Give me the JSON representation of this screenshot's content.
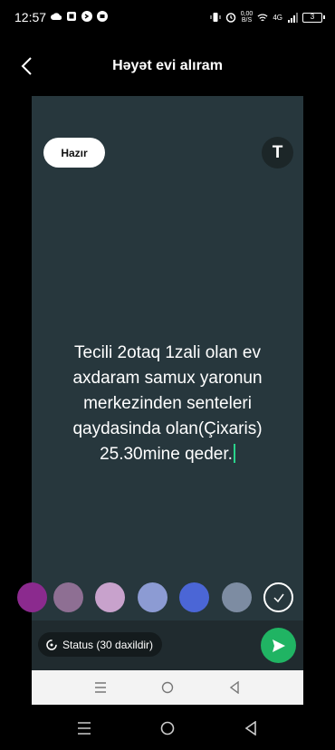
{
  "status_bar": {
    "time": "12:57",
    "speed_value": "0,00",
    "speed_unit": "B/S",
    "network": "4G",
    "battery": "3"
  },
  "header": {
    "title": "Həyət evi alıram"
  },
  "editor": {
    "done_label": "Hazır",
    "font_toggle_label": "T",
    "text": "Tecili 2otaq 1zali olan ev axdaram samux yaronun merkezinden senteleri qaydasinda olan(Çixaris) 25.30mine qeder.",
    "background_color": "#27373d"
  },
  "color_palette": [
    {
      "name": "purple",
      "color": "#8b2a8e"
    },
    {
      "name": "mauve",
      "color": "#8e6f93"
    },
    {
      "name": "lilac",
      "color": "#c8a2cc"
    },
    {
      "name": "periwinkle",
      "color": "#8c9bd3"
    },
    {
      "name": "royal-blue",
      "color": "#4b66d6"
    },
    {
      "name": "slate",
      "color": "#7d8ca2"
    },
    {
      "name": "selected",
      "color": "#27373d"
    }
  ],
  "status_row": {
    "status_label": "Status (30 daxildir)"
  },
  "colors": {
    "accent": "#20b463",
    "cursor": "#2ad38b"
  }
}
